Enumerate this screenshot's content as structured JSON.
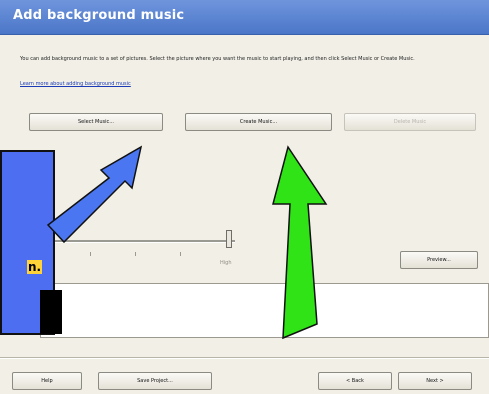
{
  "window": {
    "title": "Add background music"
  },
  "intro": {
    "text": "You can add background music to a set of pictures.  Select the picture where you want the music to start playing, and then click Select Music or Create Music.",
    "link": "Learn more about adding background music"
  },
  "buttons": {
    "select_music": "Select Music...",
    "create_music": "Create Music...",
    "delete_music": "Delete Music",
    "preview": "Preview...",
    "help": "Help",
    "save_project": "Save Project...",
    "back": "< Back",
    "next": "Next >"
  },
  "volume": {
    "high_label": "High"
  },
  "callout": {
    "text": "n."
  },
  "colors": {
    "title_bar": "#5a83d4",
    "blue_arrow": "#4a76f2",
    "green_arrow": "#2fe316",
    "callout_box": "#4d6ef0",
    "callout_highlight": "#ffd23a"
  }
}
